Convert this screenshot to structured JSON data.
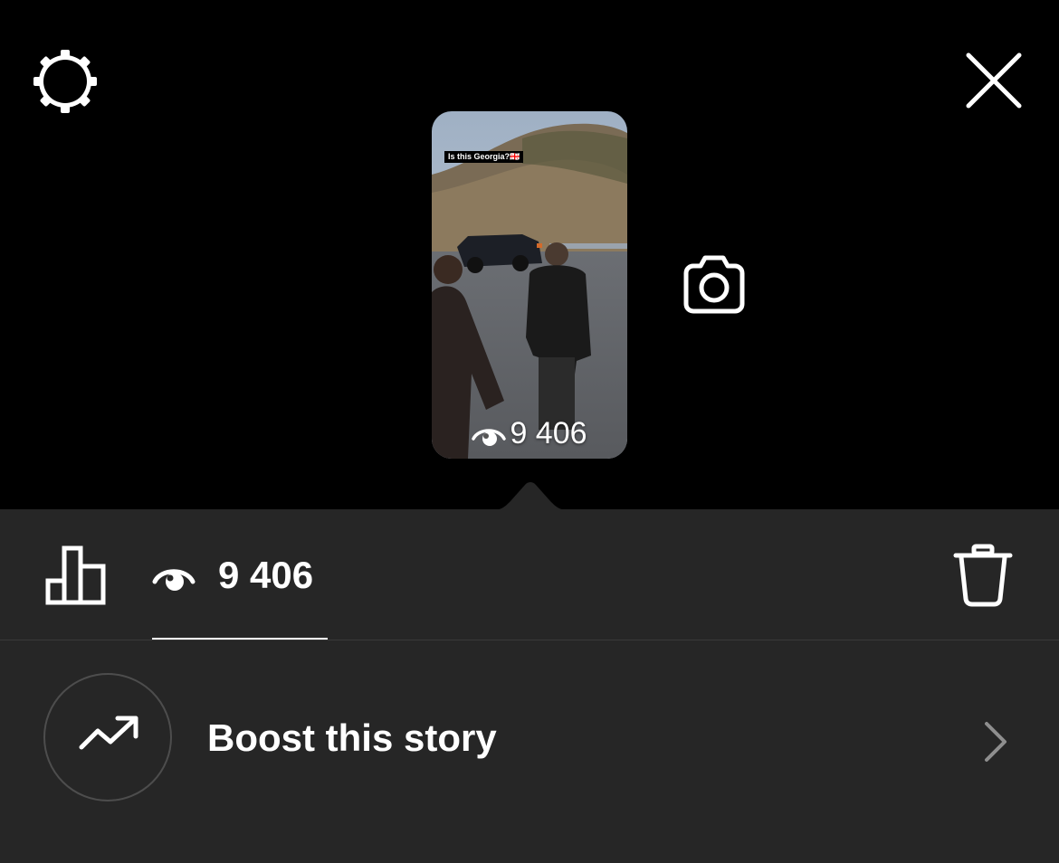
{
  "header": {
    "settings_icon": "gear-icon",
    "close_icon": "close-icon"
  },
  "story": {
    "sticker_text": "Is this Georgia?🇬🇪",
    "view_count": "9 406",
    "camera_icon": "camera-icon"
  },
  "sheet": {
    "insights_icon": "bar-chart-icon",
    "views_tab": {
      "icon": "eye-icon",
      "count": "9 406"
    },
    "delete_icon": "trash-icon",
    "boost": {
      "icon": "trending-up-icon",
      "label": "Boost this story",
      "chevron_icon": "chevron-right-icon"
    }
  },
  "colors": {
    "background": "#000000",
    "sheet": "#262626",
    "text": "#ffffff",
    "muted": "#8e8e8e"
  }
}
